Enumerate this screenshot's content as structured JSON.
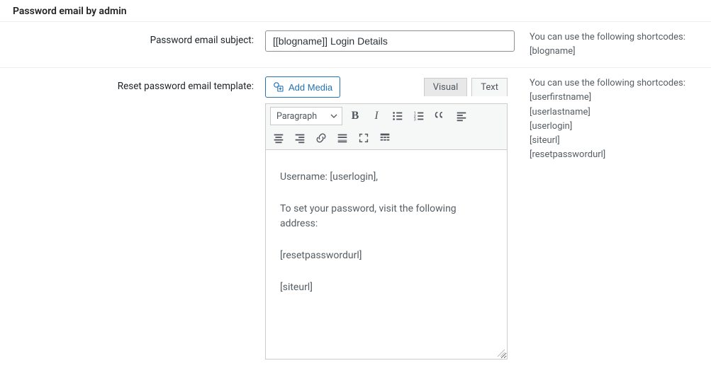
{
  "section": {
    "title": "Password email by admin"
  },
  "row_subject": {
    "label": "Password email subject:",
    "value": "[[blogname]] Login Details",
    "desc_intro": "You can use the following shortcodes:",
    "shortcodes": [
      "[blogname]"
    ]
  },
  "row_template": {
    "label": "Reset password email template:",
    "media_button": "Add Media",
    "tabs": {
      "visual": "Visual",
      "text": "Text"
    },
    "format_select": "Paragraph",
    "body_paragraphs": [
      "Username: [userlogin],",
      "To set your password, visit the following address:",
      "[resetpasswordurl]",
      "[siteurl]"
    ],
    "desc_intro": "You can use the following shortcodes:",
    "shortcodes": [
      "[userfirstname]",
      "[userlastname]",
      "[userlogin]",
      "[siteurl]",
      "[resetpasswordurl]"
    ]
  },
  "toolbar": {
    "bold": "B",
    "italic": "I"
  }
}
